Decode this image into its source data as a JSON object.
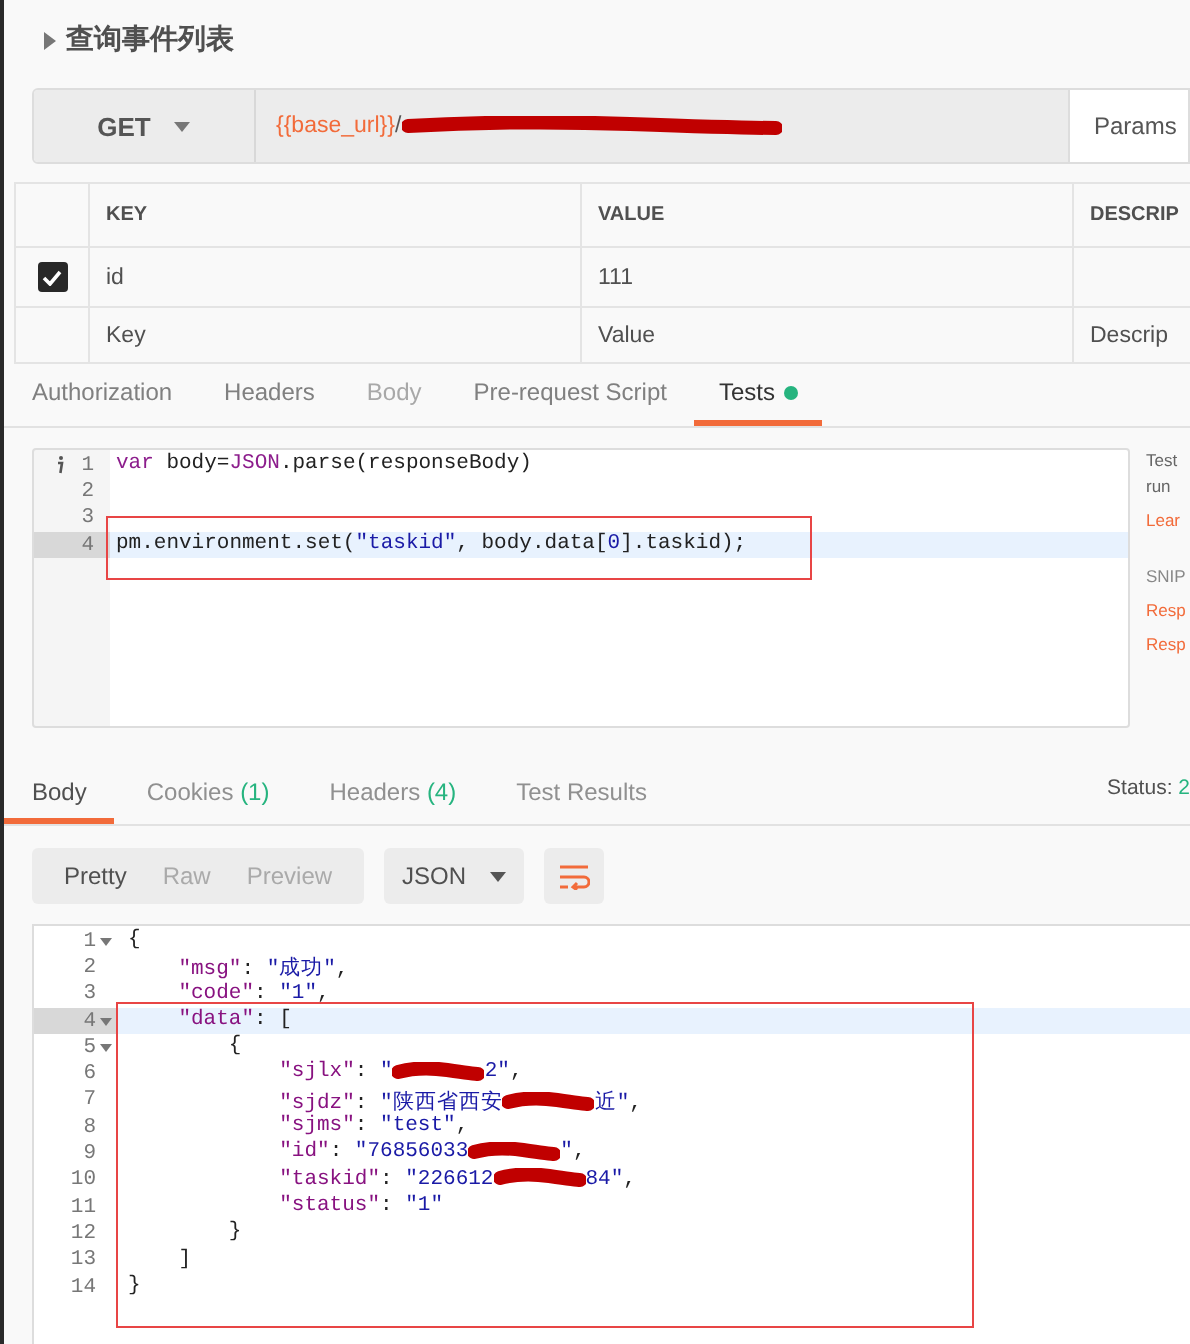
{
  "request": {
    "title": "查询事件列表",
    "method": "GET",
    "url": [
      {
        "kind": "variable",
        "text": "{{base_url}}"
      },
      {
        "kind": "plain",
        "text": "/"
      },
      {
        "kind": "redaction"
      }
    ],
    "params_button": "Params"
  },
  "params": {
    "columns": [
      "KEY",
      "VALUE",
      "DESCRIP"
    ],
    "rows": [
      {
        "checked": true,
        "key": "id",
        "value": "111"
      }
    ],
    "new_row": {
      "key_placeholder": "Key",
      "value_placeholder": "Value",
      "description_placeholder": "Descrip"
    }
  },
  "request_tabs": [
    {
      "label": "Authorization",
      "selected": false,
      "disabled": false,
      "dot": false
    },
    {
      "label": "Headers",
      "selected": false,
      "disabled": false,
      "dot": false
    },
    {
      "label": "Body",
      "selected": false,
      "disabled": true,
      "dot": false
    },
    {
      "label": "Pre-request Script",
      "selected": false,
      "disabled": false,
      "dot": false
    },
    {
      "label": "Tests",
      "selected": true,
      "disabled": false,
      "dot": true
    }
  ],
  "tests_editor": {
    "lines": [
      {
        "number": "1",
        "info": true,
        "active": false,
        "boxed": false,
        "segments": [
          {
            "kind": "keyword",
            "text": "var"
          },
          {
            "kind": "plain",
            "text": " body="
          },
          {
            "kind": "keyword",
            "text": "JSON"
          },
          {
            "kind": "plain",
            "text": ".parse(responseBody)"
          }
        ]
      },
      {
        "number": "2",
        "info": false,
        "active": false,
        "boxed": false
      },
      {
        "number": "3",
        "info": false,
        "active": false,
        "boxed": false
      },
      {
        "number": "4",
        "info": false,
        "active": true,
        "boxed": true,
        "segments": [
          {
            "kind": "plain",
            "text": "pm.environment.set("
          },
          {
            "kind": "string",
            "text": "\"taskid\""
          },
          {
            "kind": "plain",
            "text": ", body.data["
          },
          {
            "kind": "string",
            "text": "0"
          },
          {
            "kind": "plain",
            "text": "].taskid);"
          }
        ]
      }
    ]
  },
  "snippets_panel": [
    {
      "kind": "text",
      "text": "Test"
    },
    {
      "kind": "text",
      "text": "run"
    },
    {
      "kind": "link",
      "text": "Lear"
    },
    {
      "kind": "heading",
      "text": "SNIP"
    },
    {
      "kind": "link",
      "text": "Resp"
    },
    {
      "kind": "link",
      "text": "Resp"
    }
  ],
  "response_tabs": [
    {
      "label": "Body",
      "selected": true
    },
    {
      "label": "Cookies",
      "count": "(1)",
      "selected": false
    },
    {
      "label": "Headers",
      "count": "(4)",
      "selected": false
    },
    {
      "label": "Test Results",
      "selected": false
    }
  ],
  "status": {
    "label": "Status:",
    "value": "2"
  },
  "view_modes": [
    {
      "label": "Pretty",
      "selected": true
    },
    {
      "label": "Raw",
      "selected": false
    },
    {
      "label": "Preview",
      "selected": false
    }
  ],
  "format": "JSON",
  "response_body": {
    "lines": [
      {
        "number": "1",
        "foldable": true,
        "active": false,
        "boxed": false,
        "segments": [
          {
            "kind": "plain",
            "text": "{"
          }
        ]
      },
      {
        "number": "2",
        "foldable": false,
        "active": false,
        "boxed": false,
        "segments": [
          {
            "kind": "key",
            "text": "\"msg\""
          },
          {
            "kind": "plain",
            "text": ": "
          },
          {
            "kind": "string",
            "text": "\"成功\""
          },
          {
            "kind": "plain",
            "text": ","
          }
        ]
      },
      {
        "number": "3",
        "foldable": false,
        "active": false,
        "boxed": false,
        "segments": [
          {
            "kind": "key",
            "text": "\"code\""
          },
          {
            "kind": "plain",
            "text": ": "
          },
          {
            "kind": "string",
            "text": "\"1\""
          },
          {
            "kind": "plain",
            "text": ","
          }
        ]
      },
      {
        "number": "4",
        "foldable": true,
        "active": true,
        "boxed": true,
        "segments": [
          {
            "kind": "key",
            "text": "\"data\""
          },
          {
            "kind": "plain",
            "text": ": ["
          }
        ]
      },
      {
        "number": "5",
        "foldable": true,
        "active": false,
        "boxed": true,
        "segments": [
          {
            "kind": "plain",
            "text": "{"
          }
        ]
      },
      {
        "number": "6",
        "foldable": false,
        "active": false,
        "boxed": true,
        "segments": [
          {
            "kind": "key",
            "text": "\"sjlx\""
          },
          {
            "kind": "plain",
            "text": ": "
          },
          {
            "kind": "string",
            "text": "\""
          },
          {
            "kind": "redaction"
          },
          {
            "kind": "string",
            "text": "2\""
          },
          {
            "kind": "plain",
            "text": ","
          }
        ]
      },
      {
        "number": "7",
        "foldable": false,
        "active": false,
        "boxed": true,
        "segments": [
          {
            "kind": "key",
            "text": "\"sjdz\""
          },
          {
            "kind": "plain",
            "text": ": "
          },
          {
            "kind": "string",
            "text": "\"陕西省西安"
          },
          {
            "kind": "redaction"
          },
          {
            "kind": "string",
            "text": "近\""
          },
          {
            "kind": "plain",
            "text": ","
          }
        ]
      },
      {
        "number": "8",
        "foldable": false,
        "active": false,
        "boxed": true,
        "segments": [
          {
            "kind": "key",
            "text": "\"sjms\""
          },
          {
            "kind": "plain",
            "text": ": "
          },
          {
            "kind": "string",
            "text": "\"test\""
          },
          {
            "kind": "plain",
            "text": ","
          }
        ]
      },
      {
        "number": "9",
        "foldable": false,
        "active": false,
        "boxed": true,
        "segments": [
          {
            "kind": "key",
            "text": "\"id\""
          },
          {
            "kind": "plain",
            "text": ": "
          },
          {
            "kind": "string",
            "text": "\"76856033"
          },
          {
            "kind": "redaction"
          },
          {
            "kind": "string",
            "text": "\""
          },
          {
            "kind": "plain",
            "text": ","
          }
        ]
      },
      {
        "number": "10",
        "foldable": false,
        "active": false,
        "boxed": true,
        "segments": [
          {
            "kind": "key",
            "text": "\"taskid\""
          },
          {
            "kind": "plain",
            "text": ": "
          },
          {
            "kind": "string",
            "text": "\"226612"
          },
          {
            "kind": "redaction"
          },
          {
            "kind": "string",
            "text": "84\""
          },
          {
            "kind": "plain",
            "text": ","
          }
        ]
      },
      {
        "number": "11",
        "foldable": false,
        "active": false,
        "boxed": true,
        "segments": [
          {
            "kind": "key",
            "text": "\"status\""
          },
          {
            "kind": "plain",
            "text": ": "
          },
          {
            "kind": "string",
            "text": "\"1\""
          }
        ]
      },
      {
        "number": "12",
        "foldable": false,
        "active": false,
        "boxed": true,
        "segments": [
          {
            "kind": "plain",
            "text": "}"
          }
        ]
      },
      {
        "number": "13",
        "foldable": false,
        "active": false,
        "boxed": true,
        "segments": [
          {
            "kind": "plain",
            "text": "]"
          }
        ]
      },
      {
        "number": "14",
        "foldable": false,
        "active": false,
        "boxed": true,
        "segments": [
          {
            "kind": "plain",
            "text": "}"
          }
        ]
      }
    ]
  }
}
